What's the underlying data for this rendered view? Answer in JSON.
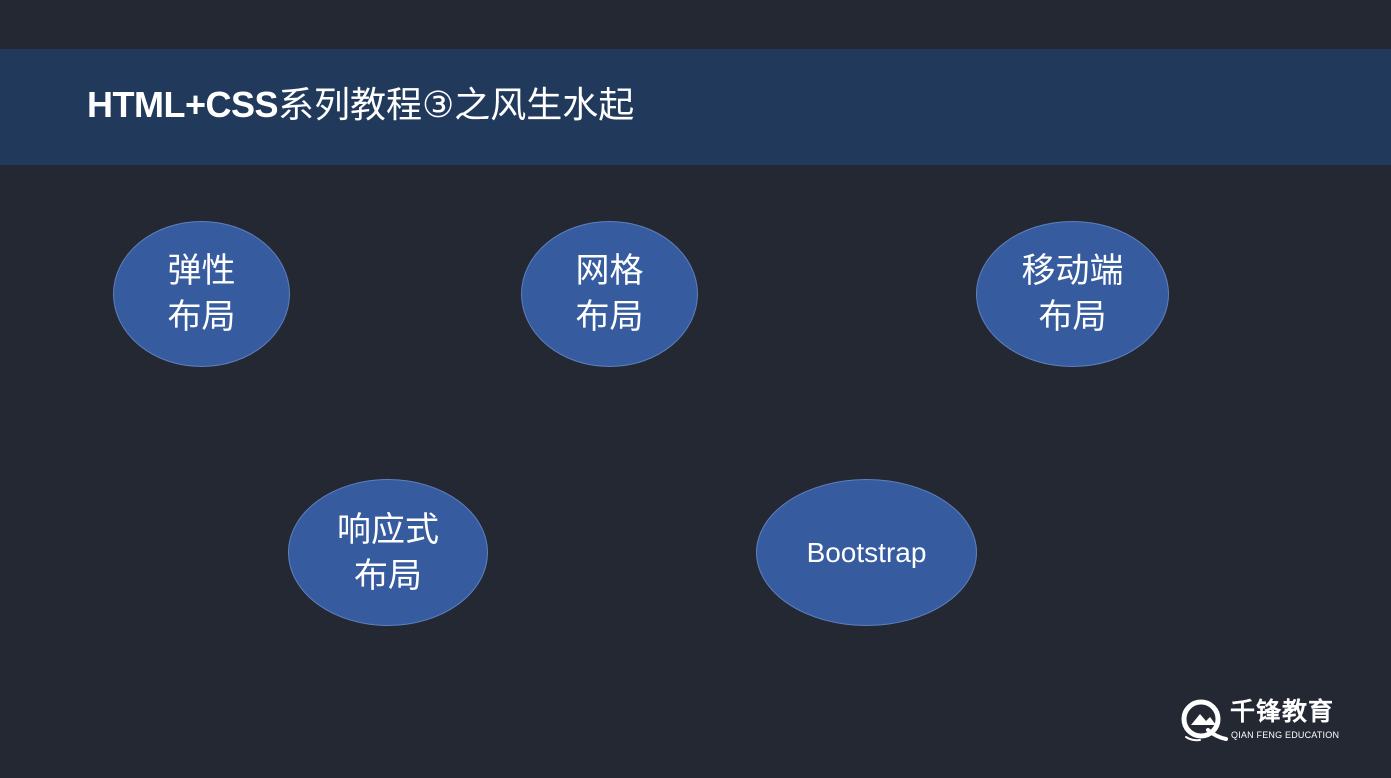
{
  "slide": {
    "title_latin": "HTML+CSS",
    "title_cn": "系列教程③之风生水起"
  },
  "bubbles": [
    {
      "line1": "弹性",
      "line2": "布局"
    },
    {
      "line1": "网格",
      "line2": "布局"
    },
    {
      "line1": "移动端",
      "line2": "布局"
    },
    {
      "line1": "响应式",
      "line2": "布局"
    },
    {
      "line1": "Bootstrap"
    }
  ],
  "logo": {
    "name_cn": "千锋教育",
    "name_en": "QIAN FENG EDUCATION",
    "icon": "qianfeng-logo-icon"
  },
  "colors": {
    "background": "#242833",
    "title_bar": "#213a5c",
    "bubble_fill": "#365b9e",
    "text": "#ffffff"
  }
}
